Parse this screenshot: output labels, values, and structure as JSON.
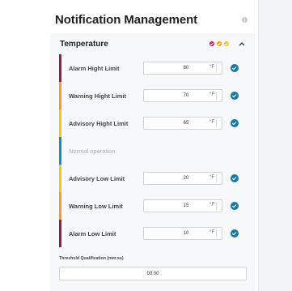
{
  "header": {
    "title": "Notification Management"
  },
  "section": {
    "title": "Temperature",
    "status_colors": [
      "#c2185b",
      "#f59e0b",
      "#f2c511"
    ]
  },
  "rows": [
    {
      "label": "Alarm Hight Limit",
      "value": "80",
      "unit": "°F",
      "color": "#8e1b4d",
      "checked": true
    },
    {
      "label": "Warning Hight Limit",
      "value": "70",
      "unit": "°F",
      "color": "#f29d2c",
      "checked": true
    },
    {
      "label": "Advisory Hight Limit",
      "value": "65",
      "unit": "°F",
      "color": "#f5c518",
      "checked": true
    },
    {
      "label": "Normal operation",
      "color": "#1b8ab8"
    },
    {
      "label": "Advisory Low Limit",
      "value": "20",
      "unit": "°F",
      "color": "#f5c518",
      "checked": true
    },
    {
      "label": "Warning Low Limit",
      "value": "15",
      "unit": "°F",
      "color": "#f29d2c",
      "checked": true
    },
    {
      "label": "Alarm Low Limit",
      "value": "10",
      "unit": "°F",
      "color": "#8e1b4d",
      "checked": true
    }
  ],
  "threshold": {
    "label": "Threshold Qualification (mm:ss)",
    "value": "00:00"
  },
  "icons": {
    "info": "info-icon",
    "collapse": "chevron-up-icon",
    "check": "check-circle-icon"
  }
}
